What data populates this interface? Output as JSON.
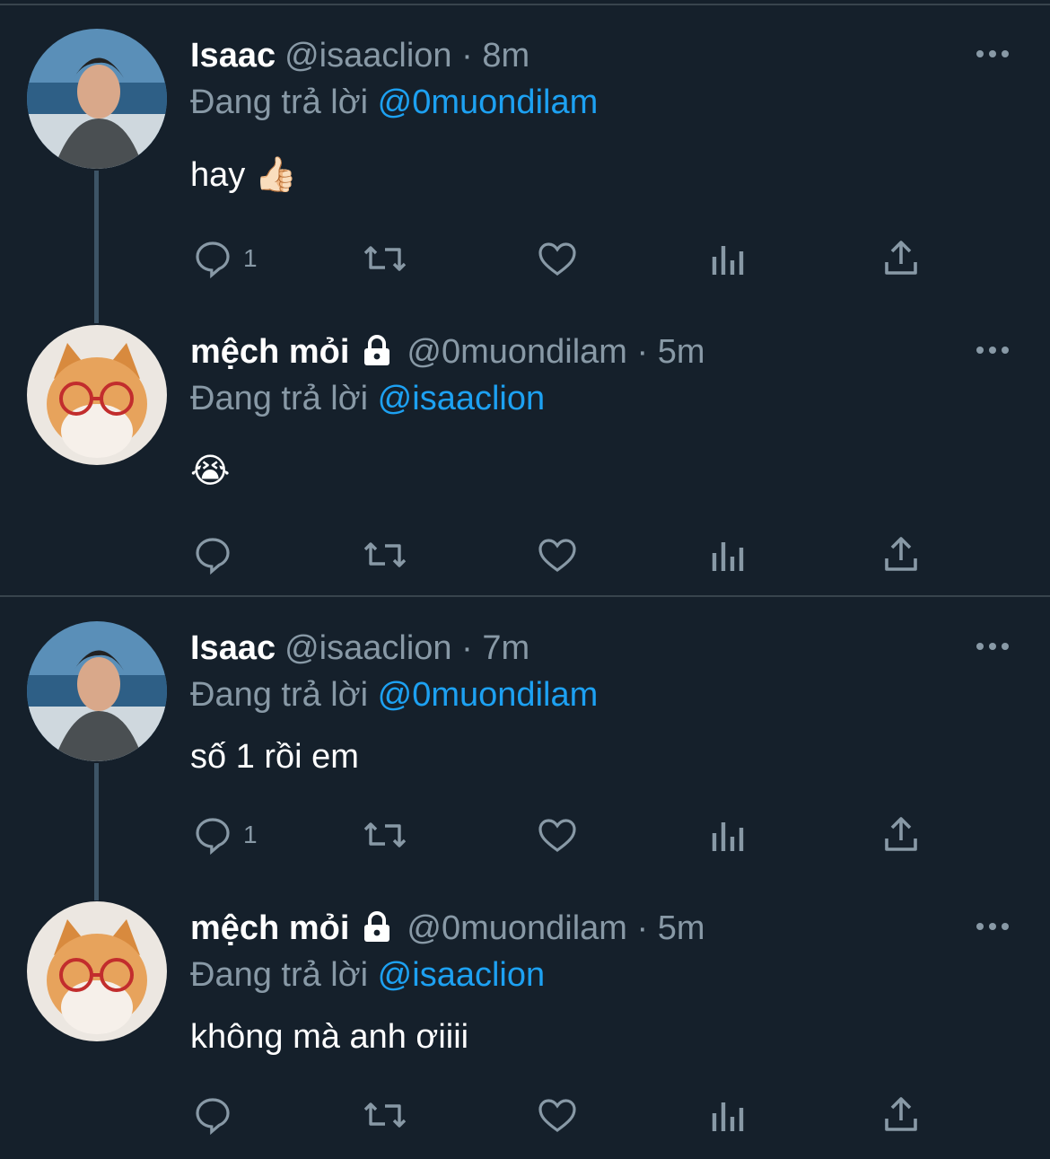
{
  "replying_label": "Đang trả lời",
  "tweets": [
    {
      "name": "Isaac",
      "handle": "@isaaclion",
      "time": "8m",
      "reply_to": "@0muondilam",
      "text": "hay",
      "emoji": "👍🏻",
      "reply_count": "1",
      "locked": false
    },
    {
      "name": "mệch mỏi",
      "handle": "@0muondilam",
      "time": "5m",
      "reply_to": "@isaaclion",
      "text": "",
      "emoji": "😭",
      "reply_count": "",
      "locked": true
    },
    {
      "name": "Isaac",
      "handle": "@isaaclion",
      "time": "7m",
      "reply_to": "@0muondilam",
      "text": "số 1 rồi em",
      "emoji": "",
      "reply_count": "1",
      "locked": false
    },
    {
      "name": "mệch mỏi",
      "handle": "@0muondilam",
      "time": "5m",
      "reply_to": "@isaaclion",
      "text": "không mà anh ơiiii",
      "emoji": "",
      "reply_count": "",
      "locked": true
    }
  ],
  "icons": [
    "reply-icon",
    "retweet-icon",
    "like-icon",
    "analytics-icon",
    "share-icon",
    "more-icon",
    "lock-icon"
  ],
  "colors": {
    "background": "#15202b",
    "secondary_text": "#8899a6",
    "mention": "#1da1f2",
    "divider": "#38444d"
  }
}
